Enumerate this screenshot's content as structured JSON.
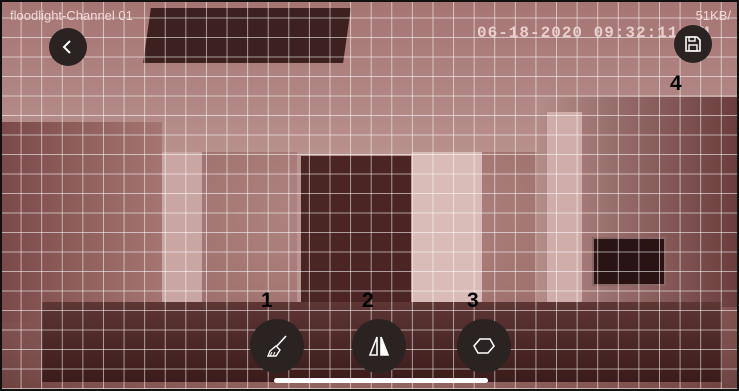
{
  "header": {
    "channel_label": "floodlight-Channel 01",
    "bitrate": "51KB/",
    "timestamp": "06-18-2020 09:32:11 AM"
  },
  "markers": [
    "1",
    "2",
    "3",
    "4"
  ],
  "icons": {
    "back": "chevron-left-icon",
    "save": "floppy-disk-icon",
    "clear": "broom-icon",
    "mirror": "mirror-triangle-icon",
    "area": "hexagon-outline-icon"
  },
  "colors": {
    "button_bg": "#2b2222",
    "grid_line": "#ffffff",
    "feed_tint": "#b48a86"
  }
}
